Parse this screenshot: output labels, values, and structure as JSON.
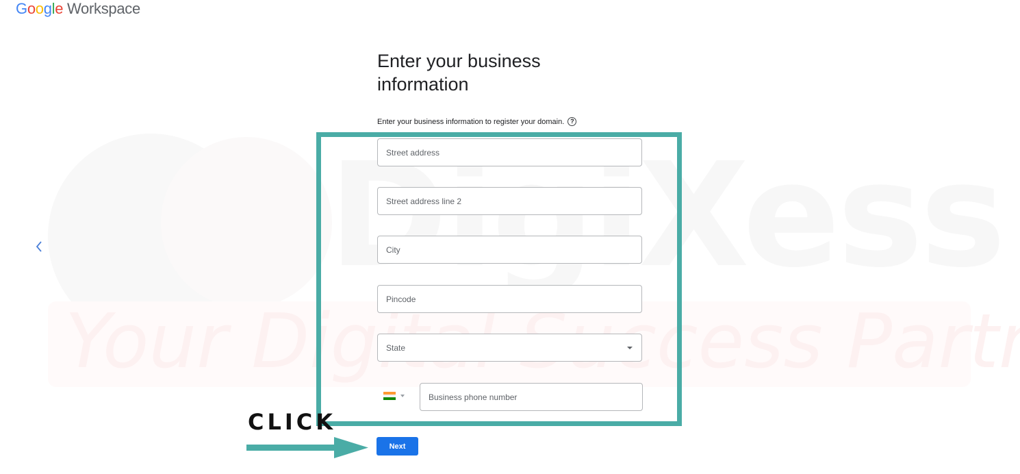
{
  "header": {
    "logo_google": [
      "G",
      "o",
      "o",
      "g",
      "l",
      "e"
    ],
    "logo_product": "Workspace"
  },
  "navigation": {
    "back_icon": "chevron-left-icon"
  },
  "watermark": {
    "brand": "DigiXess",
    "tagline": "Your Digital Success Partner"
  },
  "form": {
    "title": "Enter your business information",
    "subtitle": "Enter your business information to register your domain.",
    "help_icon": "?",
    "fields": {
      "street": {
        "placeholder": "Street address",
        "value": ""
      },
      "street2": {
        "placeholder": "Street address line 2",
        "value": ""
      },
      "city": {
        "placeholder": "City",
        "value": ""
      },
      "pincode": {
        "placeholder": "Pincode",
        "value": ""
      },
      "state": {
        "placeholder": "State",
        "selected": ""
      },
      "phone": {
        "placeholder": "Business phone number",
        "value": "",
        "country": "India"
      }
    },
    "next_label": "Next"
  },
  "annotation": {
    "click_label": "CLICK",
    "highlight_color": "#4aaca6"
  },
  "colors": {
    "primary": "#1a73e8",
    "flag_saffron": "#ff9933",
    "flag_white": "#ffffff",
    "flag_green": "#138808"
  }
}
